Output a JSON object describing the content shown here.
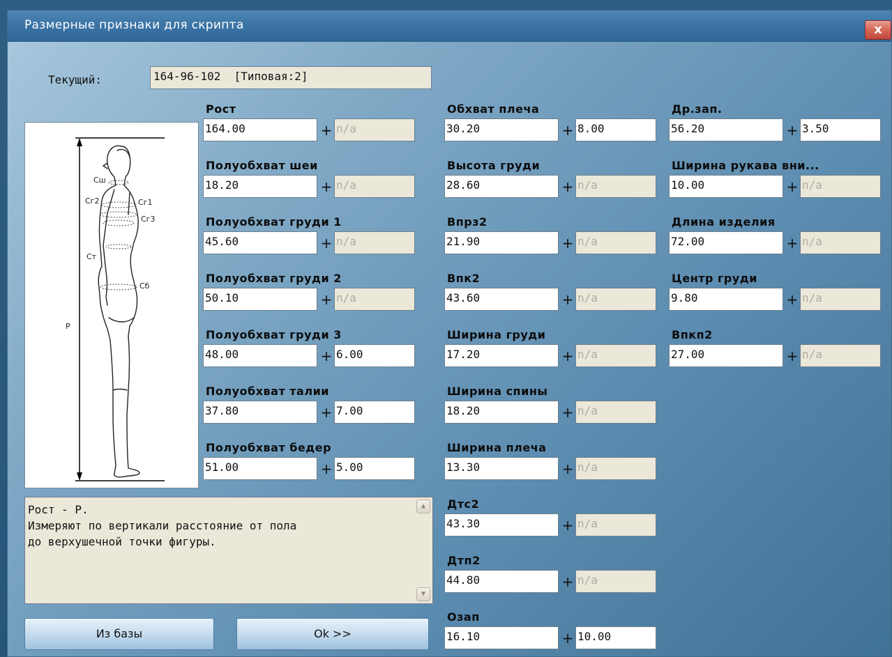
{
  "window": {
    "title": "Размерные признаки для скрипта",
    "close_label": "x"
  },
  "current": {
    "label": "Текущий:",
    "value": "164-96-102  [Типовая:2]"
  },
  "figure": {
    "labels": [
      "Сш",
      "Сг2",
      "Сг1",
      "Сг3",
      "Ст",
      "Сб",
      "Р"
    ]
  },
  "columns": [
    [
      {
        "label": "Рост",
        "value": "164.00",
        "tol": "n/a"
      },
      {
        "label": "Полуобхват шеи",
        "value": "18.20",
        "tol": "n/a"
      },
      {
        "label": "Полуобхват груди 1",
        "value": "45.60",
        "tol": "n/a"
      },
      {
        "label": "Полуобхват груди 2",
        "value": "50.10",
        "tol": "n/a"
      },
      {
        "label": "Полуобхват груди 3",
        "value": "48.00",
        "tol": "6.00"
      },
      {
        "label": "Полуобхват талии",
        "value": "37.80",
        "tol": "7.00"
      },
      {
        "label": "Полуобхват бедер",
        "value": "51.00",
        "tol": "5.00"
      }
    ],
    [
      {
        "label": "Обхват плеча",
        "value": "30.20",
        "tol": "8.00"
      },
      {
        "label": "Высота груди",
        "value": "28.60",
        "tol": "n/a"
      },
      {
        "label": "Впрз2",
        "value": "21.90",
        "tol": "n/a"
      },
      {
        "label": "Впк2",
        "value": "43.60",
        "tol": "n/a"
      },
      {
        "label": "Ширина груди",
        "value": "17.20",
        "tol": "n/a"
      },
      {
        "label": "Ширина спины",
        "value": "18.20",
        "tol": "n/a"
      },
      {
        "label": "Ширина плеча",
        "value": "13.30",
        "tol": "n/a"
      },
      {
        "label": "Дтс2",
        "value": "43.30",
        "tol": "n/a"
      },
      {
        "label": "Дтп2",
        "value": "44.80",
        "tol": "n/a"
      },
      {
        "label": "Озап",
        "value": "16.10",
        "tol": "10.00"
      }
    ],
    [
      {
        "label": "Др.зап.",
        "value": "56.20",
        "tol": "3.50"
      },
      {
        "label": "Ширина рукава вни...",
        "value": "10.00",
        "tol": "n/a"
      },
      {
        "label": "Длина изделия",
        "value": "72.00",
        "tol": "n/a"
      },
      {
        "label": "Центр груди",
        "value": "9.80",
        "tol": "n/a"
      },
      {
        "label": "Впкп2",
        "value": "27.00",
        "tol": "n/a"
      }
    ]
  ],
  "description": {
    "line1": "Рост - Р.",
    "line2": "Измеряют по вертикали расстояние от пола",
    "line3": "до верхушечной точки фигуры."
  },
  "buttons": {
    "from_db": "Из базы",
    "ok": "Ok >>"
  },
  "plus_sign": "+"
}
